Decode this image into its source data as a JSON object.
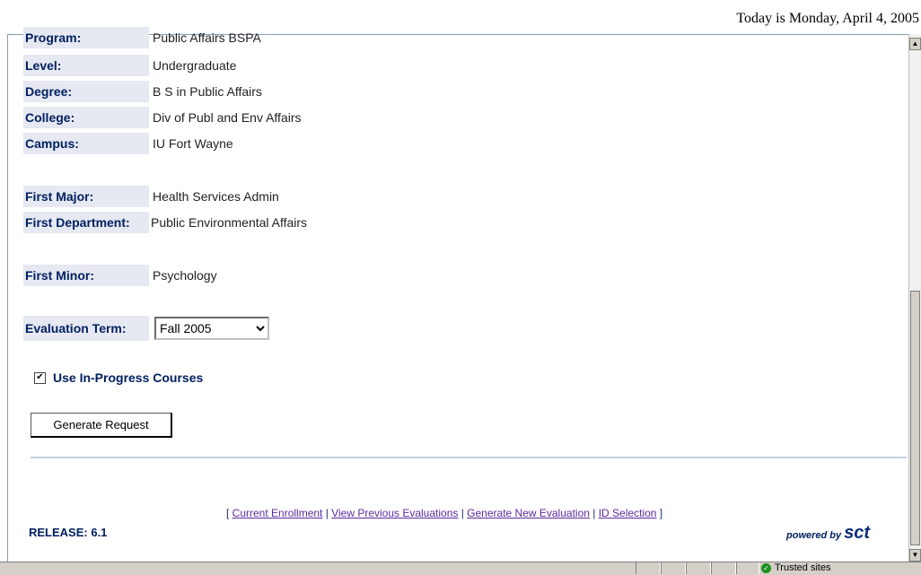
{
  "header": {
    "today_text": "Today is Monday, April 4, 2005"
  },
  "profile": {
    "program_label": "Program:",
    "program_value": "Public Affairs BSPA",
    "level_label": "Level:",
    "level_value": "Undergraduate",
    "degree_label": "Degree:",
    "degree_value": "B S in Public Affairs",
    "college_label": "College:",
    "college_value": "Div of Publ and Env Affairs",
    "campus_label": "Campus:",
    "campus_value": "IU Fort Wayne",
    "major_label": "First Major:",
    "major_value": "Health Services Admin",
    "department_label": "First Department:",
    "department_value": "Public Environmental Affairs",
    "minor_label": "First Minor:",
    "minor_value": "Psychology"
  },
  "form": {
    "term_label": "Evaluation Term:",
    "term_selected": "Fall 2005",
    "in_progress_label": "Use In-Progress Courses",
    "in_progress_checked": true,
    "generate_button": "Generate Request"
  },
  "footer": {
    "link_open": "[ ",
    "link_sep": " | ",
    "link_close": " ]",
    "links": [
      "Current Enrollment",
      "View Previous Evaluations",
      "Generate New Evaluation",
      "ID Selection"
    ],
    "release": "RELEASE: 6.1",
    "powered_by": "powered by",
    "brand": "sct"
  },
  "statusbar": {
    "zone": "Trusted sites"
  },
  "icons": {
    "trusted": "check-circle-icon",
    "scroll_up": "arrow-up-icon",
    "scroll_down": "arrow-down-icon",
    "dropdown": "chevron-down-icon"
  }
}
